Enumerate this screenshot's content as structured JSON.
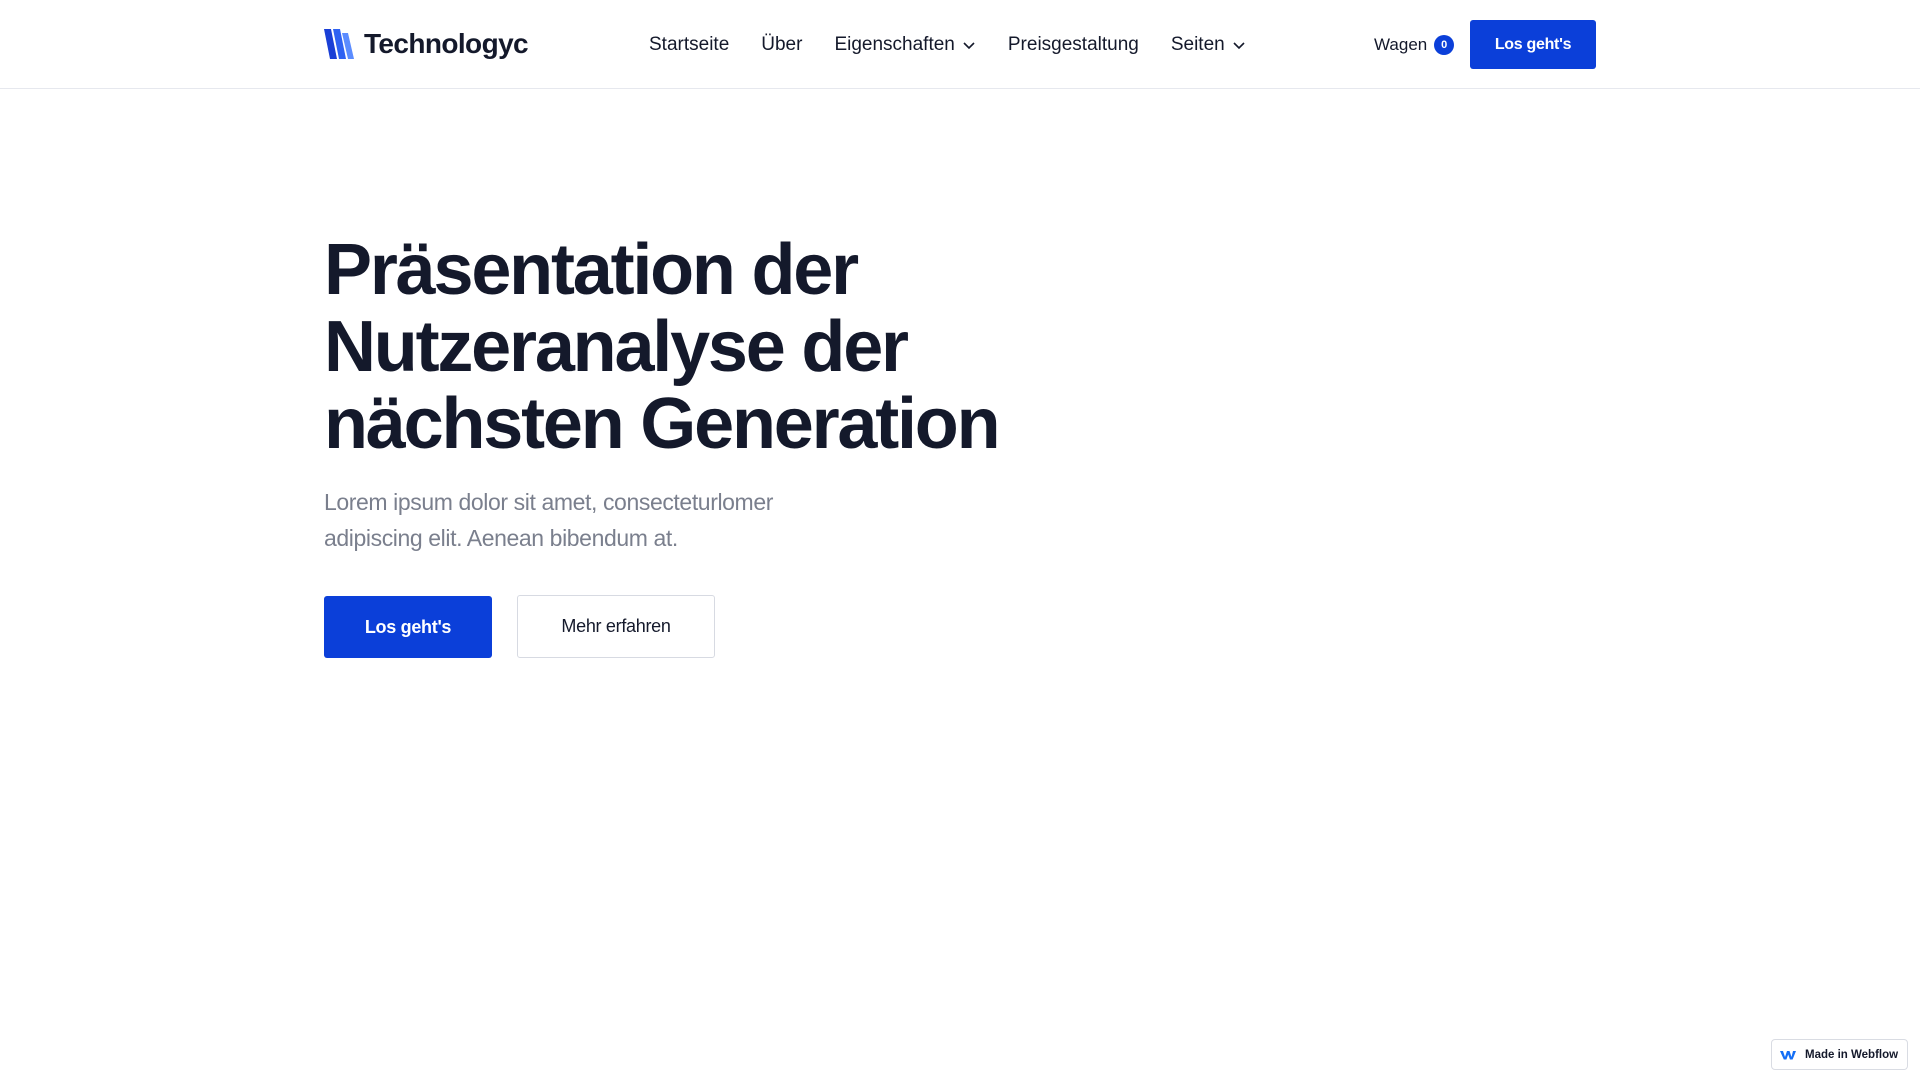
{
  "brand": {
    "name": "Technologyc",
    "accent_color": "#0b3fd9",
    "logo_icon": "brand-logo-icon"
  },
  "nav": {
    "items": [
      {
        "label": "Startseite",
        "has_dropdown": false
      },
      {
        "label": "Über",
        "has_dropdown": false
      },
      {
        "label": "Eigenschaften",
        "has_dropdown": true
      },
      {
        "label": "Preisgestaltung",
        "has_dropdown": false
      },
      {
        "label": "Seiten",
        "has_dropdown": true
      }
    ],
    "dropdown_icon": "chevron-down-icon"
  },
  "cart": {
    "label": "Wagen",
    "count": "0"
  },
  "header_cta": {
    "label": "Los geht's"
  },
  "hero": {
    "title_lines": [
      "Präsentation der",
      "Nutzeranalyse der",
      "nächsten Generation"
    ],
    "subtitle_lines": [
      "Lorem ipsum dolor sit amet, consecteturlomer",
      "adipiscing elit. Aenean bibendum at."
    ],
    "primary_button": "Los geht's",
    "secondary_button": "Mehr erfahren"
  },
  "webflow_badge": {
    "label": "Made in Webflow",
    "icon": "webflow-icon"
  }
}
